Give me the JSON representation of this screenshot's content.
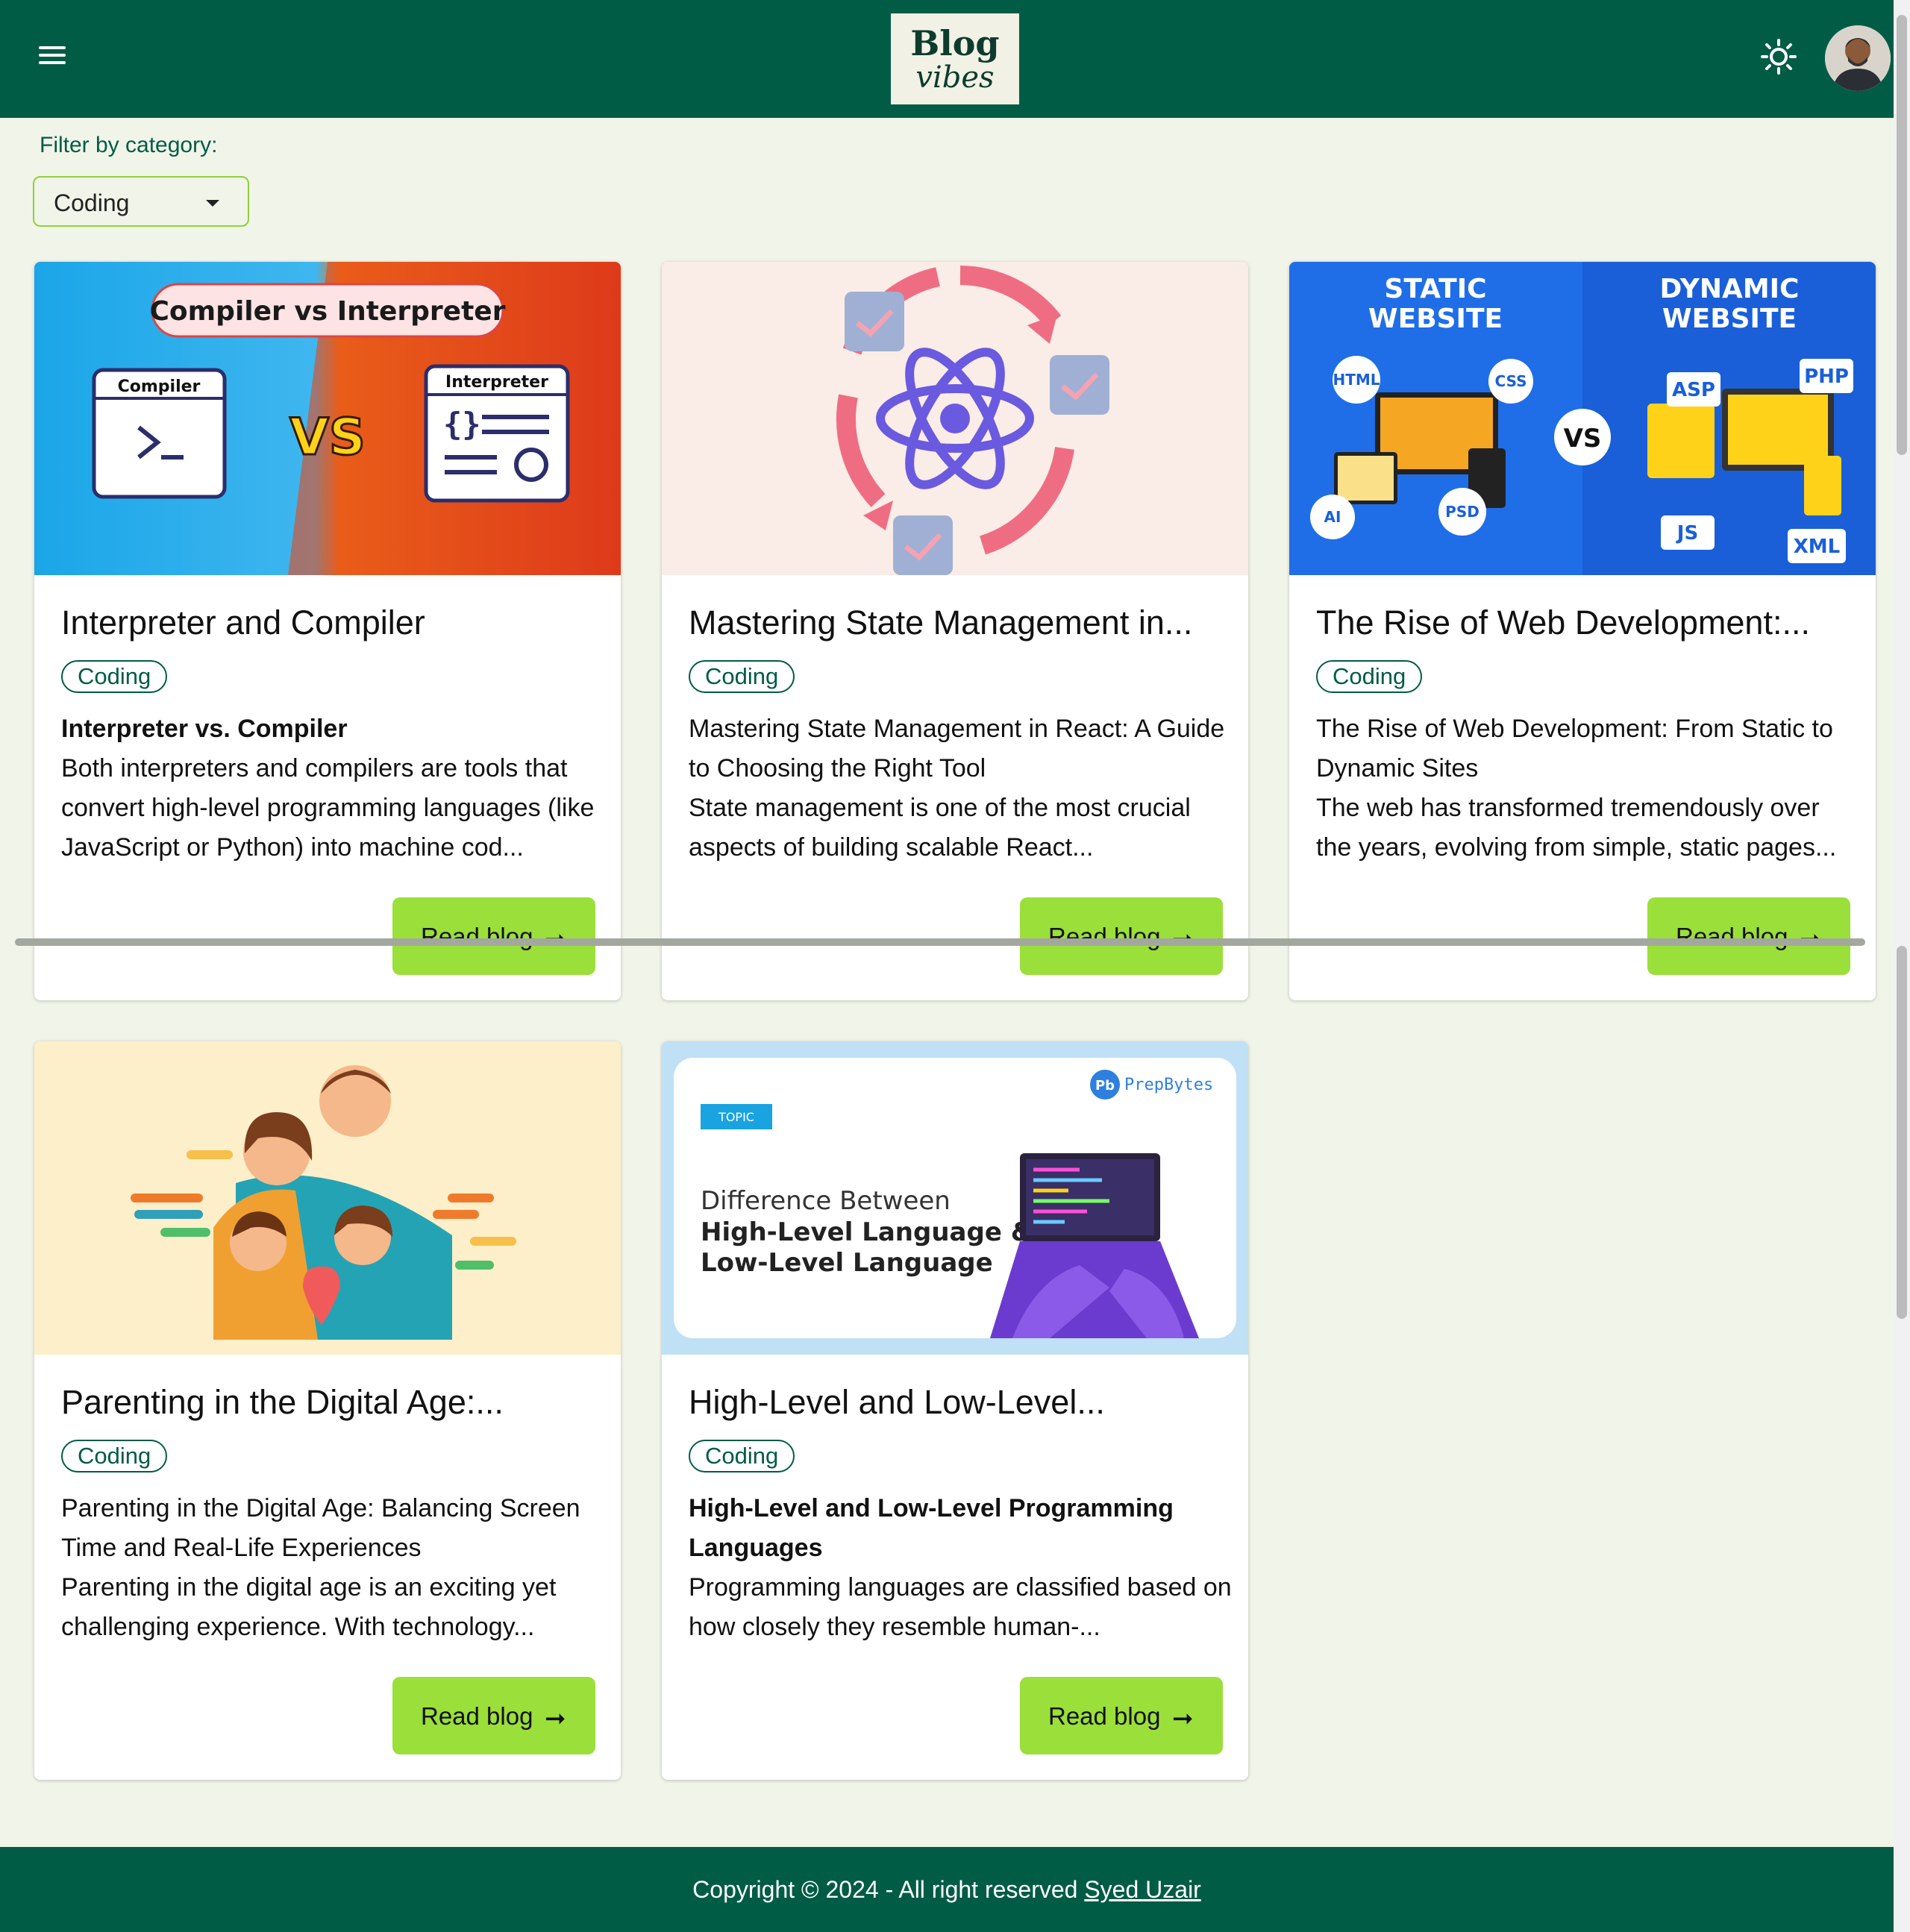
{
  "header": {
    "logo_line1": "Blog",
    "logo_line2": "vibes",
    "menu_icon": "hamburger-icon",
    "theme_icon": "sun-icon"
  },
  "filter": {
    "label": "Filter by category:",
    "selected": "Coding"
  },
  "cards": [
    {
      "title": "Interpreter and Compiler",
      "category": "Coding",
      "subtitle": "Interpreter vs. Compiler",
      "excerpt": "Both interpreters and compilers are tools that convert high-level programming languages (like JavaScript or Python) into machine cod...",
      "button": "Read blog",
      "image_text": {
        "banner": "Compiler vs Interpreter",
        "left": "Compiler",
        "right": "Interpreter",
        "vs": "VS"
      }
    },
    {
      "title": "Mastering State Management in...",
      "category": "Coding",
      "subtitle": "Mastering State Management in React: A Guide to Choosing the Right Tool",
      "excerpt": "State management is one of the most crucial aspects of building scalable React...",
      "button": "Read blog"
    },
    {
      "title": "The Rise of Web Development:...",
      "category": "Coding",
      "subtitle": "The Rise of Web Development: From Static to Dynamic Sites",
      "excerpt": "The web has transformed tremendously over the years, evolving from simple, static pages...",
      "button": "Read blog",
      "image_text": {
        "left": "STATIC WEBSITE",
        "right": "DYNAMIC WEBSITE",
        "vs": "VS",
        "tags": [
          "HTML",
          "CSS",
          "AI",
          "PSD",
          "ASP",
          "PHP",
          "JS",
          "XML"
        ]
      }
    },
    {
      "title": "Parenting in the Digital Age:...",
      "category": "Coding",
      "subtitle": "Parenting in the Digital Age: Balancing Screen Time and Real-Life Experiences",
      "excerpt": "Parenting in the digital age is an exciting yet challenging experience. With technology...",
      "button": "Read blog"
    },
    {
      "title": "High-Level and Low-Level...",
      "category": "Coding",
      "subtitle": "High-Level and Low-Level Programming Languages",
      "excerpt": "Programming languages are classified based on how closely they resemble human-...",
      "button": "Read blog",
      "image_text": {
        "brand": "PrepBytes",
        "tag": "TOPIC",
        "line1": "Difference Between",
        "line2": "High-Level Language &",
        "line3": "Low-Level Language"
      }
    }
  ],
  "footer": {
    "text": "Copyright © 2024 - All right reserved",
    "author": "Syed Uzair"
  },
  "colors": {
    "primary": "#015c45",
    "accent": "#9bdf3a",
    "background": "#f1f4e8"
  }
}
